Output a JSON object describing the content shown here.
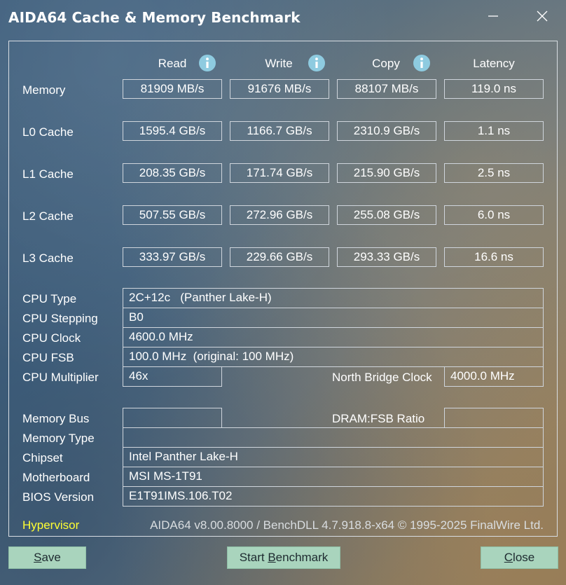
{
  "window": {
    "title": "AIDA64 Cache & Memory Benchmark",
    "minimize_icon": "minimize-icon",
    "close_icon": "close-icon"
  },
  "columns": [
    "Read",
    "Write",
    "Copy",
    "Latency"
  ],
  "info_icon": "info-icon",
  "bench_rows": [
    {
      "label": "Memory",
      "read": "81909 MB/s",
      "write": "91676 MB/s",
      "copy": "88107 MB/s",
      "latency": "119.0 ns"
    },
    {
      "label": "L0 Cache",
      "read": "1595.4 GB/s",
      "write": "1166.7 GB/s",
      "copy": "2310.9 GB/s",
      "latency": "1.1 ns"
    },
    {
      "label": "L1 Cache",
      "read": "208.35 GB/s",
      "write": "171.74 GB/s",
      "copy": "215.90 GB/s",
      "latency": "2.5 ns"
    },
    {
      "label": "L2 Cache",
      "read": "507.55 GB/s",
      "write": "272.96 GB/s",
      "copy": "255.08 GB/s",
      "latency": "6.0 ns"
    },
    {
      "label": "L3 Cache",
      "read": "333.97 GB/s",
      "write": "229.66 GB/s",
      "copy": "293.33 GB/s",
      "latency": "16.6 ns"
    }
  ],
  "cpu": {
    "type_label": "CPU Type",
    "type_value": "2C+12c   (Panther Lake-H)",
    "stepping_label": "CPU Stepping",
    "stepping_value": "B0",
    "clock_label": "CPU Clock",
    "clock_value": "4600.0 MHz",
    "fsb_label": "CPU FSB",
    "fsb_value": "100.0 MHz  (original: 100 MHz)",
    "multiplier_label": "CPU Multiplier",
    "multiplier_value": "46x",
    "nb_clock_label": "North Bridge Clock",
    "nb_clock_value": "4000.0 MHz"
  },
  "memory": {
    "bus_label": "Memory Bus",
    "bus_value": "",
    "dram_ratio_label": "DRAM:FSB Ratio",
    "dram_ratio_value": "",
    "type_label": "Memory Type",
    "type_value": "",
    "chipset_label": "Chipset",
    "chipset_value": "Intel Panther Lake-H",
    "motherboard_label": "Motherboard",
    "motherboard_value": "MSI MS-1T91",
    "bios_label": "BIOS Version",
    "bios_value": "E1T91IMS.106.T02"
  },
  "status": {
    "hypervisor": "Hypervisor",
    "version": "AIDA64 v8.00.8000 / BenchDLL 4.7.918.8-x64 © 1995-2025 FinalWire Ltd."
  },
  "buttons": {
    "save_mnemonic": "S",
    "save_rest": "ave",
    "start_prefix": "Start ",
    "start_mnemonic": "B",
    "start_rest": "enchmark",
    "close_mnemonic": "C",
    "close_rest": "lose"
  },
  "colors": {
    "button_bg": "#a9d4bd",
    "hypervisor": "#ffff33",
    "info_icon": "#8ecbe0"
  }
}
